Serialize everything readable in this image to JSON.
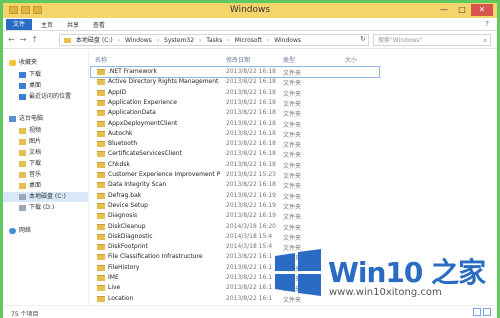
{
  "window": {
    "title": "Windows",
    "minimize": "—",
    "maximize": "□",
    "close": "✕"
  },
  "ribbon": {
    "file_tab": "文件",
    "tabs": [
      "主页",
      "共享",
      "查看"
    ],
    "help": "?"
  },
  "address": {
    "back": "←",
    "forward": "→",
    "up": "↑",
    "segments": [
      "本地磁盘 (C:)",
      "Windows",
      "System32",
      "Tasks",
      "Microsoft",
      "Windows"
    ],
    "separator": "›",
    "refresh": "↻",
    "search_placeholder": "搜索\"Windows\"",
    "search_icon": "⌕"
  },
  "sidebar": {
    "items": [
      {
        "label": "收藏夹",
        "icon": "star-icon"
      },
      {
        "label": "下载",
        "icon": "download-icon"
      },
      {
        "label": "桌面",
        "icon": "desktop-icon"
      },
      {
        "label": "最近访问的位置",
        "icon": "recent-icon"
      },
      {
        "label": "这台电脑",
        "icon": "computer-icon"
      },
      {
        "label": "视频",
        "icon": "video-folder-icon"
      },
      {
        "label": "图片",
        "icon": "picture-folder-icon"
      },
      {
        "label": "文档",
        "icon": "document-folder-icon"
      },
      {
        "label": "下载",
        "icon": "download-folder-icon"
      },
      {
        "label": "音乐",
        "icon": "music-folder-icon"
      },
      {
        "label": "桌面",
        "icon": "desktop-folder-icon"
      },
      {
        "label": "本地磁盘 (C:)",
        "icon": "drive-icon",
        "selected": true
      },
      {
        "label": "下载 (D:)",
        "icon": "drive-icon"
      },
      {
        "label": "网络",
        "icon": "network-icon"
      }
    ]
  },
  "columns": {
    "name": "名称",
    "date": "修改日期",
    "type": "类型",
    "size": "大小"
  },
  "files": [
    {
      "name": ".NET Framework",
      "date": "2013/8/22 16:18",
      "type": "文件夹"
    },
    {
      "name": "Active Directory Rights Management ...",
      "date": "2013/8/22 16:18",
      "type": "文件夹"
    },
    {
      "name": "AppID",
      "date": "2013/8/22 16:18",
      "type": "文件夹"
    },
    {
      "name": "Application Experience",
      "date": "2013/8/22 16:18",
      "type": "文件夹"
    },
    {
      "name": "ApplicationData",
      "date": "2013/8/22 16:18",
      "type": "文件夹"
    },
    {
      "name": "AppxDeploymentClient",
      "date": "2013/8/22 16:18",
      "type": "文件夹"
    },
    {
      "name": "Autochk",
      "date": "2013/8/22 16:18",
      "type": "文件夹"
    },
    {
      "name": "Bluetooth",
      "date": "2013/8/22 16:18",
      "type": "文件夹"
    },
    {
      "name": "CertificateServicesClient",
      "date": "2013/8/22 16:18",
      "type": "文件夹"
    },
    {
      "name": "Chkdsk",
      "date": "2013/8/22 16:18",
      "type": "文件夹"
    },
    {
      "name": "Customer Experience Improvement P...",
      "date": "2013/8/22 15:23",
      "type": "文件夹"
    },
    {
      "name": "Data Integrity Scan",
      "date": "2013/8/22 16:18",
      "type": "文件夹"
    },
    {
      "name": "Defrag.bak",
      "date": "2013/8/22 16:19",
      "type": "文件夹"
    },
    {
      "name": "Device Setup",
      "date": "2013/8/22 16:19",
      "type": "文件夹"
    },
    {
      "name": "Diagnosis",
      "date": "2013/8/22 16:19",
      "type": "文件夹"
    },
    {
      "name": "DiskCleanup",
      "date": "2014/3/18 16:20",
      "type": "文件夹"
    },
    {
      "name": "DiskDiagnostic",
      "date": "2014/3/18 15:4",
      "type": "文件夹"
    },
    {
      "name": "DiskFootprint",
      "date": "2014/3/18 15:4",
      "type": "文件夹"
    },
    {
      "name": "File Classification Infrastructure",
      "date": "2013/8/22 16:1",
      "type": "文件夹"
    },
    {
      "name": "FileHistory",
      "date": "2013/8/22 16:1",
      "type": "文件夹"
    },
    {
      "name": "IME",
      "date": "2013/8/22 16:1",
      "type": "文件夹"
    },
    {
      "name": "Live",
      "date": "2013/8/22 16:1",
      "type": "文件夹"
    },
    {
      "name": "Location",
      "date": "2013/8/22 16:1",
      "type": "文件夹"
    }
  ],
  "status": {
    "count": "75 个项目"
  },
  "watermark": {
    "brand": "Win10",
    "suffix": "之家",
    "url": "www.win10xitong.com"
  },
  "colors": {
    "accent": "#2a6cc4",
    "frame": "#5fc95f",
    "titlebar": "#f3d56b",
    "folder": "#e6bf52"
  }
}
